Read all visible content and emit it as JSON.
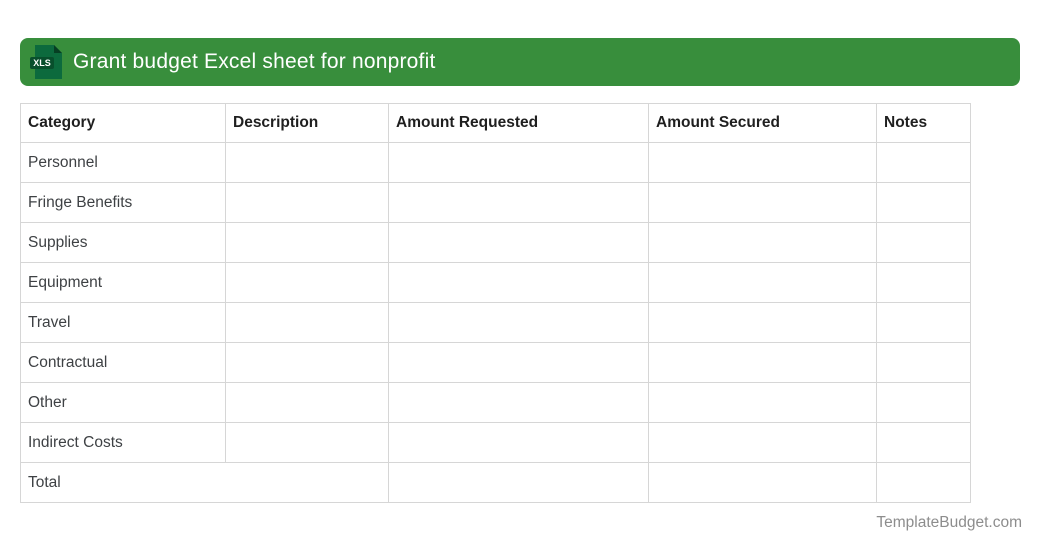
{
  "banner": {
    "title": "Grant budget Excel sheet for nonprofit",
    "icon_label": "XLS"
  },
  "table": {
    "headers": [
      "Category",
      "Description",
      "Amount Requested",
      "Amount Secured",
      "Notes"
    ],
    "rows": [
      "Personnel",
      "Fringe Benefits",
      "Supplies",
      "Equipment",
      "Travel",
      "Contractual",
      "Other",
      "Indirect Costs"
    ],
    "total_label": "Total"
  },
  "footer": {
    "site": "TemplateBudget.com"
  },
  "colors": {
    "banner_green": "#388e3c",
    "icon_doc_green": "#0c6a3d",
    "icon_fold_green": "#063f23",
    "icon_badge_green": "#084f2c",
    "grid_line": "#d6d6d6",
    "header_text": "#1f1f1f",
    "cell_text": "#3e4144",
    "footer_text": "#8d8d8d"
  }
}
